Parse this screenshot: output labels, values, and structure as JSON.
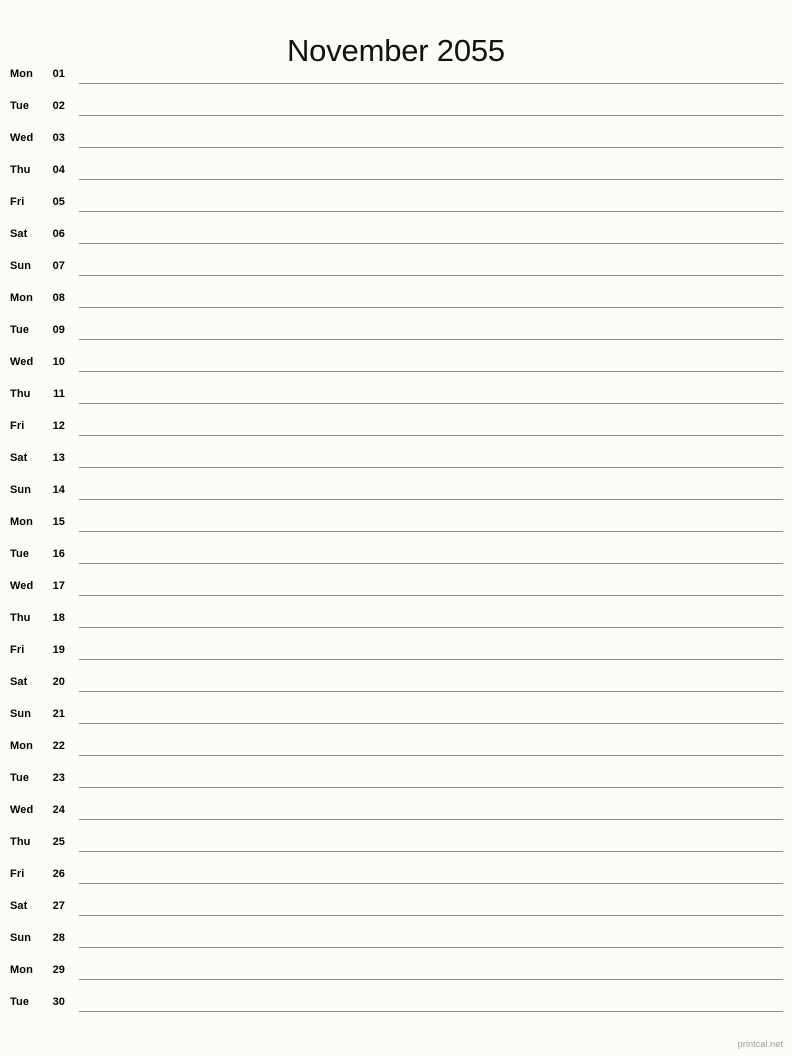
{
  "header": {
    "title": "November 2055",
    "month_name": "November",
    "year": "2055"
  },
  "calendar": {
    "days_in_month": 30,
    "rows": [
      {
        "weekday": "Mon",
        "date": "01"
      },
      {
        "weekday": "Tue",
        "date": "02"
      },
      {
        "weekday": "Wed",
        "date": "03"
      },
      {
        "weekday": "Thu",
        "date": "04"
      },
      {
        "weekday": "Fri",
        "date": "05"
      },
      {
        "weekday": "Sat",
        "date": "06"
      },
      {
        "weekday": "Sun",
        "date": "07"
      },
      {
        "weekday": "Mon",
        "date": "08"
      },
      {
        "weekday": "Tue",
        "date": "09"
      },
      {
        "weekday": "Wed",
        "date": "10"
      },
      {
        "weekday": "Thu",
        "date": "11"
      },
      {
        "weekday": "Fri",
        "date": "12"
      },
      {
        "weekday": "Sat",
        "date": "13"
      },
      {
        "weekday": "Sun",
        "date": "14"
      },
      {
        "weekday": "Mon",
        "date": "15"
      },
      {
        "weekday": "Tue",
        "date": "16"
      },
      {
        "weekday": "Wed",
        "date": "17"
      },
      {
        "weekday": "Thu",
        "date": "18"
      },
      {
        "weekday": "Fri",
        "date": "19"
      },
      {
        "weekday": "Sat",
        "date": "20"
      },
      {
        "weekday": "Sun",
        "date": "21"
      },
      {
        "weekday": "Mon",
        "date": "22"
      },
      {
        "weekday": "Tue",
        "date": "23"
      },
      {
        "weekday": "Wed",
        "date": "24"
      },
      {
        "weekday": "Thu",
        "date": "25"
      },
      {
        "weekday": "Fri",
        "date": "26"
      },
      {
        "weekday": "Sat",
        "date": "27"
      },
      {
        "weekday": "Sun",
        "date": "28"
      },
      {
        "weekday": "Mon",
        "date": "29"
      },
      {
        "weekday": "Tue",
        "date": "30"
      }
    ]
  },
  "footer": {
    "credit": "printcal.net"
  },
  "colors": {
    "page_background": "#fcfdf9",
    "text": "#000000",
    "title_text": "#111111",
    "rule_line": "#8a8d86",
    "footer_text": "#9a9a9a"
  }
}
